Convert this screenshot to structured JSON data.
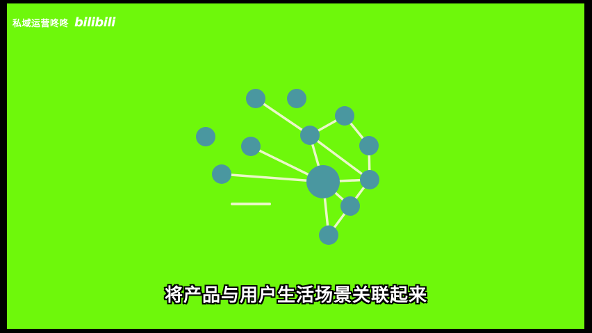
{
  "watermark": {
    "channel": "私域运营咚咚",
    "brand": "bilibili"
  },
  "subtitle": {
    "text": "将产品与用户生活场景关联起来"
  },
  "colors": {
    "background": "#6ef80b",
    "node": "#4a97a0",
    "edge": "#eaf7c8",
    "text": "#ffffff"
  }
}
